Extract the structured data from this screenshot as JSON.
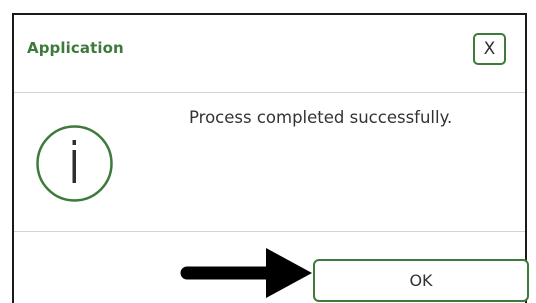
{
  "dialog": {
    "title": "Application",
    "close_label": "X",
    "message": "Process completed successfully.",
    "ok_label": "OK",
    "icon": "info-icon"
  },
  "annotation": {
    "icon": "arrow-right-icon"
  },
  "colors": {
    "accent": "#3d7a3b",
    "border": "#1a1a1a",
    "divider": "#d4d4d4",
    "text": "#333333"
  }
}
